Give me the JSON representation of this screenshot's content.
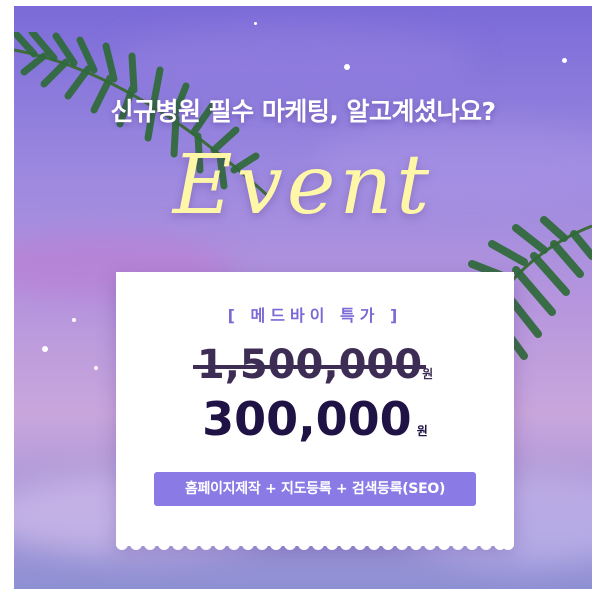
{
  "banner": {
    "headline": "신규병원 필수 마케팅, 알고계셨나요?",
    "event_word": "Event"
  },
  "ticket": {
    "special_label": "[ 메드바이 특가 ]",
    "original_price": "1,500,000",
    "original_unit": "원",
    "sale_price": "300,000",
    "sale_unit": "원",
    "services": "홈페이지제작 + 지도등록 + 검색등록(SEO)"
  },
  "colors": {
    "sky_top": "#7b6bd8",
    "sky_mid": "#c9a6dc",
    "event_text": "#fff7a8",
    "accent": "#8a7ae6",
    "price_text": "#1f1245"
  },
  "icons": [
    "palm-leaf-top-left",
    "palm-leaf-right"
  ]
}
